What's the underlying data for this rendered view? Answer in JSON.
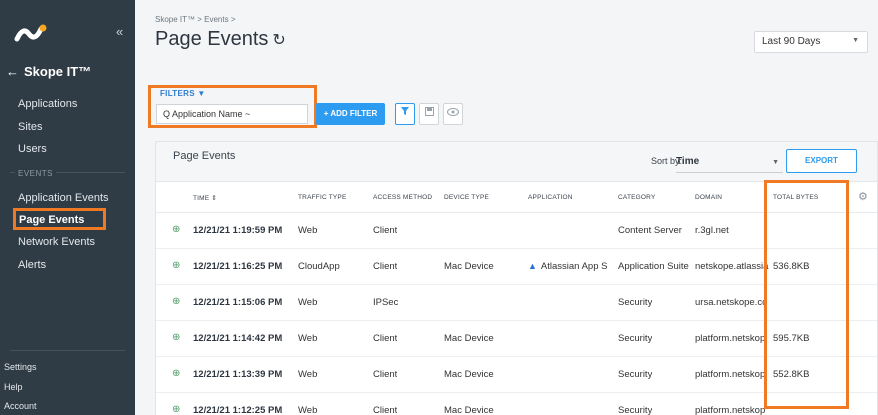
{
  "sidebar": {
    "collapse_icon": "«",
    "back_label": "Skope IT™",
    "items": [
      {
        "label": "Applications"
      },
      {
        "label": "Sites"
      },
      {
        "label": "Users"
      }
    ],
    "section_events": "EVENTS",
    "event_items": [
      {
        "label": "Application Events"
      },
      {
        "label": "Page Events",
        "active": true
      },
      {
        "label": "Network Events"
      },
      {
        "label": "Alerts"
      }
    ],
    "bottom_items": [
      {
        "label": "Settings"
      },
      {
        "label": "Help"
      },
      {
        "label": "Account"
      }
    ]
  },
  "header": {
    "breadcrumb": "Skope IT™ > Events >",
    "title": "Page Events",
    "refresh_icon": "↻",
    "range": "Last 90 Days"
  },
  "filters": {
    "label": "FILTERS ▼",
    "input_value": "Q Application Name ~",
    "add_filter": "+ ADD FILTER",
    "icons": [
      "filter-icon",
      "save-icon",
      "view-icon"
    ]
  },
  "card": {
    "title": "Page Events",
    "sort_by_label": "Sort by:",
    "sort_value": "Time",
    "export_label": "EXPORT",
    "columns": [
      "TIME ⇕",
      "TRAFFIC TYPE",
      "ACCESS METHOD",
      "DEVICE TYPE",
      "APPLICATION",
      "CATEGORY",
      "DOMAIN",
      "TOTAL BYTES"
    ],
    "rows": [
      {
        "time": "12/21/21 1:19:59 PM",
        "traffic": "Web",
        "access": "Client",
        "device": "",
        "application": "",
        "category": "Content Server",
        "domain": "r.3gl.net",
        "bytes": ""
      },
      {
        "time": "12/21/21 1:16:25 PM",
        "traffic": "CloudApp",
        "access": "Client",
        "device": "Mac Device",
        "application": "Atlassian App S",
        "category": "Application Suite",
        "domain": "netskope.atlassia",
        "bytes": "536.8KB"
      },
      {
        "time": "12/21/21 1:15:06 PM",
        "traffic": "Web",
        "access": "IPSec",
        "device": "",
        "application": "",
        "category": "Security",
        "domain": "ursa.netskope.cc",
        "bytes": ""
      },
      {
        "time": "12/21/21 1:14:42 PM",
        "traffic": "Web",
        "access": "Client",
        "device": "Mac Device",
        "application": "",
        "category": "Security",
        "domain": "platform.netskop",
        "bytes": "595.7KB"
      },
      {
        "time": "12/21/21 1:13:39 PM",
        "traffic": "Web",
        "access": "Client",
        "device": "Mac Device",
        "application": "",
        "category": "Security",
        "domain": "platform.netskop",
        "bytes": "552.8KB"
      },
      {
        "time": "12/21/21 1:12:25 PM",
        "traffic": "Web",
        "access": "Client",
        "device": "Mac Device",
        "application": "",
        "category": "Security",
        "domain": "platform.netskop",
        "bytes": ""
      }
    ]
  },
  "colors": {
    "sidebar_bg": "#2f3b45",
    "accent": "#2d9bf0",
    "highlight": "#f07a24"
  }
}
